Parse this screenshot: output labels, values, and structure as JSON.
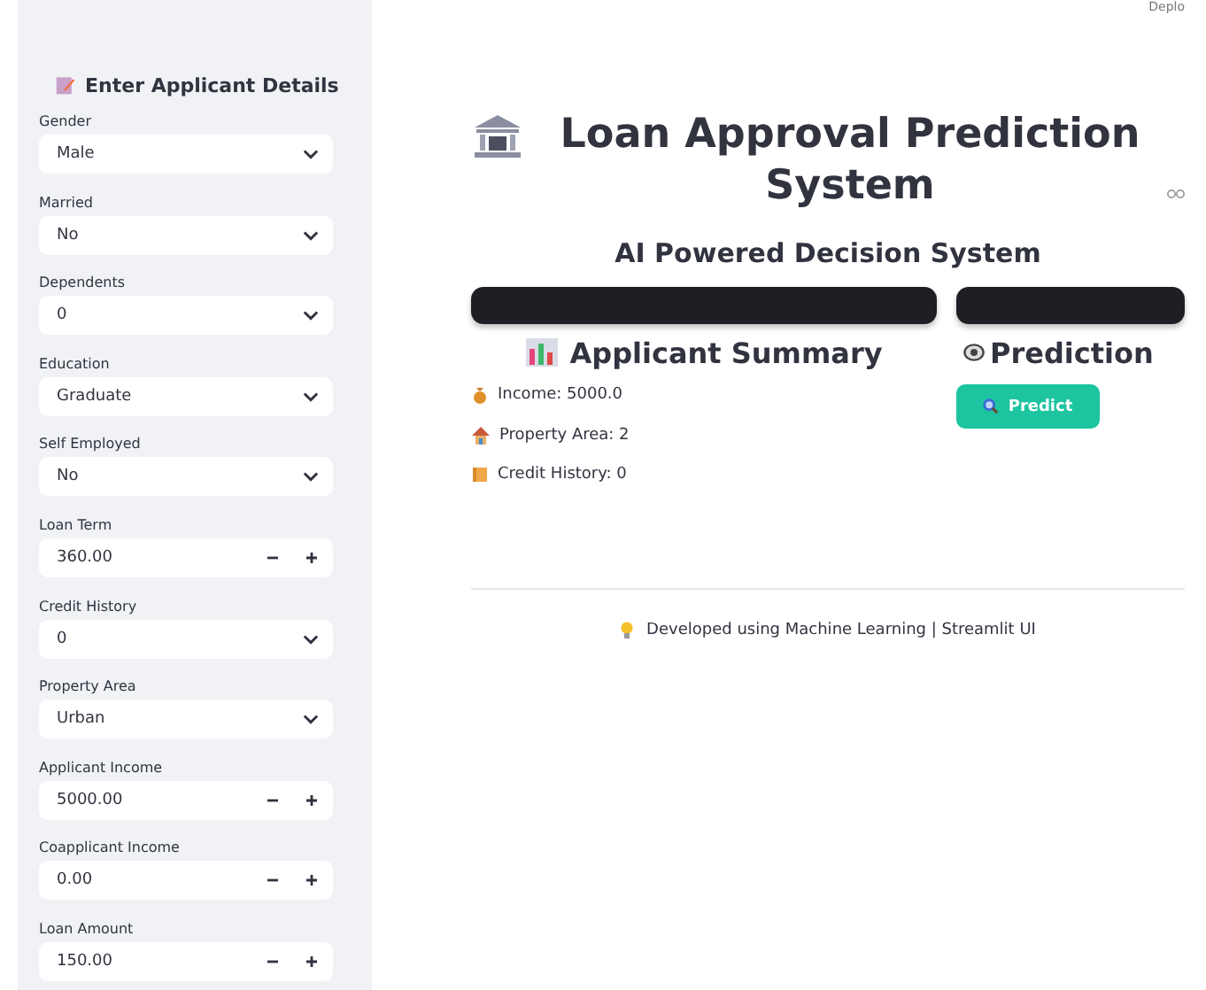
{
  "sidebar": {
    "title": "Enter Applicant Details",
    "fields": [
      {
        "kind": "select",
        "label": "Gender",
        "value": "Male"
      },
      {
        "kind": "select",
        "label": "Married",
        "value": "No"
      },
      {
        "kind": "select",
        "label": "Dependents",
        "value": "0"
      },
      {
        "kind": "select",
        "label": "Education",
        "value": "Graduate"
      },
      {
        "kind": "select",
        "label": "Self Employed",
        "value": "No"
      },
      {
        "kind": "number",
        "label": "Loan Term",
        "value": "360.00"
      },
      {
        "kind": "select",
        "label": "Credit History",
        "value": "0"
      },
      {
        "kind": "select",
        "label": "Property Area",
        "value": "Urban"
      },
      {
        "kind": "number",
        "label": "Applicant Income",
        "value": "5000.00"
      },
      {
        "kind": "number",
        "label": "Coapplicant Income",
        "value": "0.00"
      },
      {
        "kind": "number",
        "label": "Loan Amount",
        "value": "150.00"
      }
    ]
  },
  "header": {
    "menu": "Deplo"
  },
  "main": {
    "title": "Loan Approval Prediction System",
    "subtitle": "AI Powered Decision System",
    "summary": {
      "heading": "Applicant Summary",
      "items": [
        {
          "kind": "income",
          "text": "Income: 5000.0"
        },
        {
          "kind": "property",
          "text": "Property Area: 2"
        },
        {
          "kind": "credit",
          "text": "Credit History: 0"
        }
      ]
    },
    "prediction": {
      "heading": "Prediction",
      "button": "Predict"
    },
    "footer": "Developed using Machine Learning | Streamlit UI"
  }
}
